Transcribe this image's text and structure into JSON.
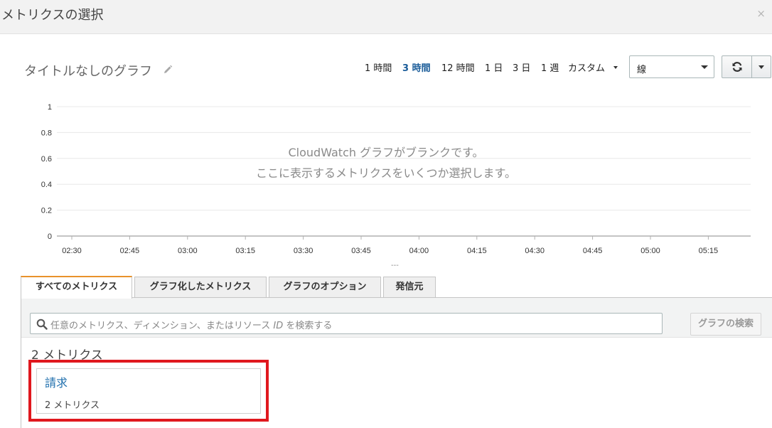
{
  "modal": {
    "title": "メトリクスの選択",
    "close_glyph": "×"
  },
  "graph": {
    "title": "タイトルなしのグラフ"
  },
  "time_ranges": [
    {
      "label": "1 時間",
      "active": false
    },
    {
      "label": "3 時間",
      "active": true
    },
    {
      "label": "12 時間",
      "active": false
    },
    {
      "label": "1 日",
      "active": false
    },
    {
      "label": "3 日",
      "active": false
    },
    {
      "label": "1 週",
      "active": false
    },
    {
      "label": "カスタム",
      "active": false
    }
  ],
  "chart_type_select": {
    "value": "線"
  },
  "chart_data": {
    "type": "line",
    "title": "",
    "xlabel": "",
    "ylabel": "",
    "x": [
      "02:30",
      "02:45",
      "03:00",
      "03:15",
      "03:30",
      "03:45",
      "04:00",
      "04:15",
      "04:30",
      "04:45",
      "05:00",
      "05:15"
    ],
    "y_ticks": [
      "0",
      "0.2",
      "0.4",
      "0.6",
      "0.8",
      "1"
    ],
    "ylim": [
      0,
      1
    ],
    "series": [],
    "grid": true,
    "empty_message": [
      "CloudWatch グラフがブランクです。",
      "ここに表示するメトリクスをいくつか選択します。"
    ]
  },
  "resize_handle": "---",
  "tabs": [
    {
      "label": "すべてのメトリクス",
      "active": true
    },
    {
      "label": "グラフ化したメトリクス",
      "active": false
    },
    {
      "label": "グラフのオプション",
      "active": false
    },
    {
      "label": "発信元",
      "active": false
    }
  ],
  "search": {
    "placeholder_pre": "任意のメトリクス、ディメンション、またはリソース ",
    "placeholder_id": "ID",
    "placeholder_post": " を検索する",
    "button_label": "グラフの検索"
  },
  "results": {
    "count_label": "2 メトリクス",
    "namespaces": [
      {
        "title": "請求",
        "subtitle": "2 メトリクス"
      }
    ]
  },
  "colors": {
    "accent_tab": "#e8922c",
    "link": "#1f6fad",
    "highlight": "#e0181e"
  }
}
